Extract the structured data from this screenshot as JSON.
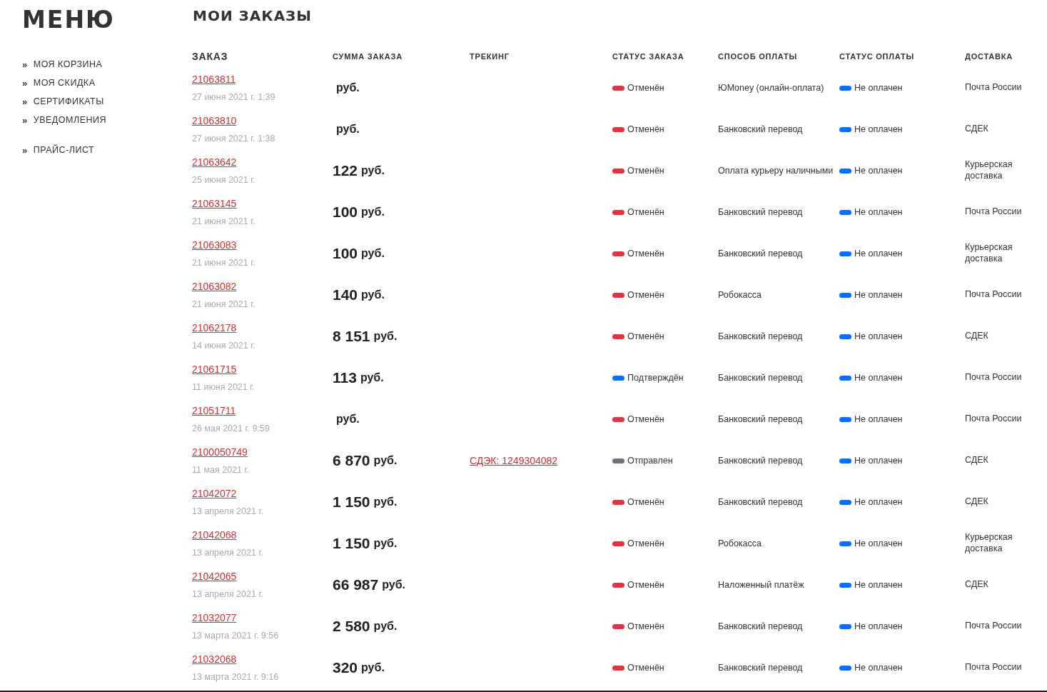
{
  "sidebar": {
    "title": "МЕНЮ",
    "sections": [
      {
        "items": [
          {
            "marker": "»",
            "label": "МОЯ КОРЗИНА"
          },
          {
            "marker": "»",
            "label": "МОЯ СКИДКА"
          },
          {
            "marker": "»",
            "label": "СЕРТИФИКАТЫ"
          },
          {
            "marker": "»",
            "label": "УВЕДОМЛЕНИЯ"
          }
        ]
      },
      {
        "items": [
          {
            "marker": "»",
            "label": "ПРАЙС-ЛИСТ"
          }
        ]
      }
    ]
  },
  "page_title": "МОИ ЗАКАЗЫ",
  "table": {
    "columns": [
      "ЗАКАЗ",
      "СУММА ЗАКАЗА",
      "ТРЕКИНГ",
      "СТАТУС ЗАКАЗА",
      "СПОСОБ ОПЛАТЫ",
      "СТАТУС ОПЛАТЫ",
      "ДОСТАВКА"
    ],
    "rows": [
      {
        "order": "21063811",
        "date": "27 июня 2021 г. 1:39",
        "currency": "руб.",
        "status": {
          "text": "Отменён",
          "color": "#dc3545"
        },
        "payment": "ЮMoney (онлайн-оплата)",
        "payment_status": {
          "text": "Не оплачен",
          "color": "#0d6efd"
        },
        "delivery": "Почта России"
      },
      {
        "order": "21063810",
        "date": "27 июня 2021 г. 1:38",
        "currency": "руб.",
        "status": {
          "text": "Отменён",
          "color": "#dc3545"
        },
        "payment": "Банковский перевод",
        "payment_status": {
          "text": "Не оплачен",
          "color": "#0d6efd"
        },
        "delivery": "СДЕК"
      },
      {
        "order": "21063642",
        "date": "25 июня 2021 г.",
        "amount": "122",
        "currency": "руб.",
        "status": {
          "text": "Отменён",
          "color": "#dc3545"
        },
        "payment": "Оплата курьеру наличными",
        "payment_status": {
          "text": "Не оплачен",
          "color": "#0d6efd"
        },
        "delivery": "Курьерская доставка"
      },
      {
        "order": "21063145",
        "date": "21 июня 2021 г.",
        "amount": "100",
        "currency": "руб.",
        "status": {
          "text": "Отменён",
          "color": "#dc3545"
        },
        "payment": "Банковский перевод",
        "payment_status": {
          "text": "Не оплачен",
          "color": "#0d6efd"
        },
        "delivery": "Почта России"
      },
      {
        "order": "21063083",
        "date": "21 июня 2021 г.",
        "amount": "100",
        "currency": "руб.",
        "status": {
          "text": "Отменён",
          "color": "#dc3545"
        },
        "payment": "Банковский перевод",
        "payment_status": {
          "text": "Не оплачен",
          "color": "#0d6efd"
        },
        "delivery": "Курьерская доставка"
      },
      {
        "order": "21063082",
        "date": "21 июня 2021 г.",
        "amount": "140",
        "currency": "руб.",
        "status": {
          "text": "Отменён",
          "color": "#dc3545"
        },
        "payment": "Робокасса",
        "payment_status": {
          "text": "Не оплачен",
          "color": "#0d6efd"
        },
        "delivery": "Почта России"
      },
      {
        "order": "21062178",
        "date": "14 июня 2021 г.",
        "amount": "8 151",
        "currency": "руб.",
        "status": {
          "text": "Отменён",
          "color": "#dc3545"
        },
        "payment": "Банковский перевод",
        "payment_status": {
          "text": "Не оплачен",
          "color": "#0d6efd"
        },
        "delivery": "СДЕК"
      },
      {
        "order": "21061715",
        "date": "11 июня 2021 г.",
        "amount": "113",
        "currency": "руб.",
        "status": {
          "text": "Подтверждён",
          "color": "#0d6efd"
        },
        "payment": "Банковский перевод",
        "payment_status": {
          "text": "Не оплачен",
          "color": "#0d6efd"
        },
        "delivery": "Почта России"
      },
      {
        "order": "21051711",
        "date": "26 мая 2021 г. 9:59",
        "currency": "руб.",
        "status": {
          "text": "Отменён",
          "color": "#dc3545"
        },
        "payment": "Банковский перевод",
        "payment_status": {
          "text": "Не оплачен",
          "color": "#0d6efd"
        },
        "delivery": "Почта России"
      },
      {
        "order": "2100050749",
        "date": "11 мая 2021 г.",
        "amount": "6 870",
        "currency": "руб.",
        "tracking": "СДЭК: 1249304082",
        "status": {
          "text": "Отправлен",
          "color": "#6c757d"
        },
        "payment": "Банковский перевод",
        "payment_status": {
          "text": "Не оплачен",
          "color": "#0d6efd"
        },
        "delivery": "СДЕК"
      },
      {
        "order": "21042072",
        "date": "13 апреля 2021 г.",
        "amount": "1 150",
        "currency": "руб.",
        "status": {
          "text": "Отменён",
          "color": "#dc3545"
        },
        "payment": "Банковский перевод",
        "payment_status": {
          "text": "Не оплачен",
          "color": "#0d6efd"
        },
        "delivery": "СДЕК"
      },
      {
        "order": "21042068",
        "date": "13 апреля 2021 г.",
        "amount": "1 150",
        "currency": "руб.",
        "status": {
          "text": "Отменён",
          "color": "#dc3545"
        },
        "payment": "Робокасса",
        "payment_status": {
          "text": "Не оплачен",
          "color": "#0d6efd"
        },
        "delivery": "Курьерская доставка"
      },
      {
        "order": "21042065",
        "date": "13 апреля 2021 г.",
        "amount": "66 987",
        "currency": "руб.",
        "status": {
          "text": "Отменён",
          "color": "#dc3545"
        },
        "payment": "Наложенный платёж",
        "payment_status": {
          "text": "Не оплачен",
          "color": "#0d6efd"
        },
        "delivery": "СДЕК"
      },
      {
        "order": "21032077",
        "date": "13 марта 2021 г. 9:56",
        "amount": "2 580",
        "currency": "руб.",
        "status": {
          "text": "Отменён",
          "color": "#dc3545"
        },
        "payment": "Банковский перевод",
        "payment_status": {
          "text": "Не оплачен",
          "color": "#0d6efd"
        },
        "delivery": "Почта России"
      },
      {
        "order": "21032068",
        "date": "13 марта 2021 г. 9:16",
        "amount": "320",
        "currency": "руб.",
        "status": {
          "text": "Отменён",
          "color": "#dc3545"
        },
        "payment": "Банковский перевод",
        "payment_status": {
          "text": "Не оплачен",
          "color": "#0d6efd"
        },
        "delivery": "Почта России"
      }
    ]
  }
}
